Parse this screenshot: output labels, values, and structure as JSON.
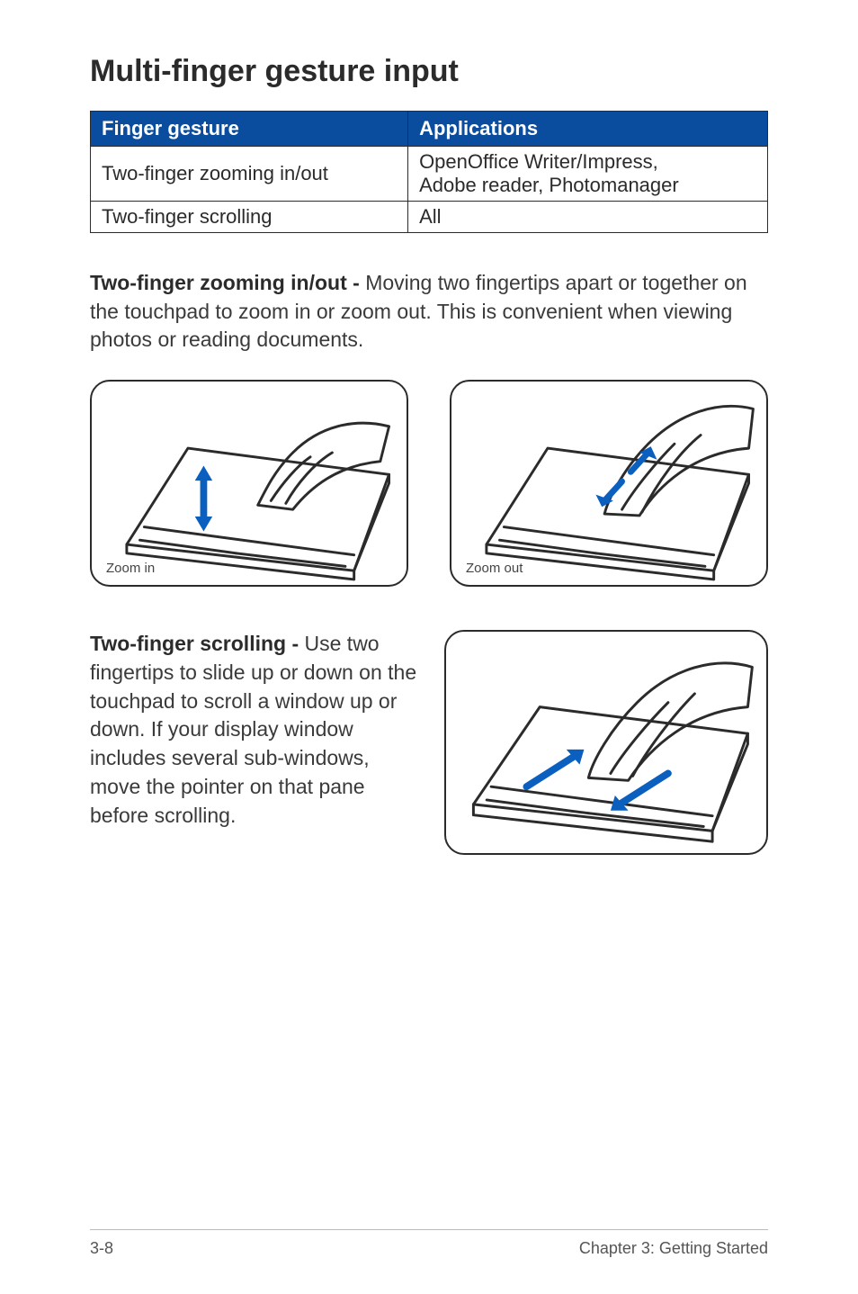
{
  "heading": "Multi-finger gesture input",
  "table": {
    "headers": {
      "col1": "Finger gesture",
      "col2": "Applications"
    },
    "rows": [
      {
        "gesture": "Two-finger zooming in/out",
        "apps_line1": "OpenOffice Writer/Impress,",
        "apps_line2": "Adobe reader, Photomanager"
      },
      {
        "gesture": "Two-finger scrolling",
        "apps": "All"
      }
    ]
  },
  "paragraphs": {
    "zoom": {
      "title": "Two-finger zooming in/out - ",
      "body": "Moving two fingertips apart or together on the touchpad to zoom in or zoom out. This is convenient when viewing photos or reading documents."
    },
    "scroll": {
      "title": "Two-finger scrolling - ",
      "body": "Use two fingertips to slide up or down on the touchpad to scroll a window up or down. If your display window includes several sub-windows, move the pointer on that pane before scrolling."
    }
  },
  "illus_labels": {
    "zoom_in": "Zoom in",
    "zoom_out": "Zoom out"
  },
  "footer": {
    "page": "3-8",
    "chapter": "Chapter 3: Getting Started"
  }
}
